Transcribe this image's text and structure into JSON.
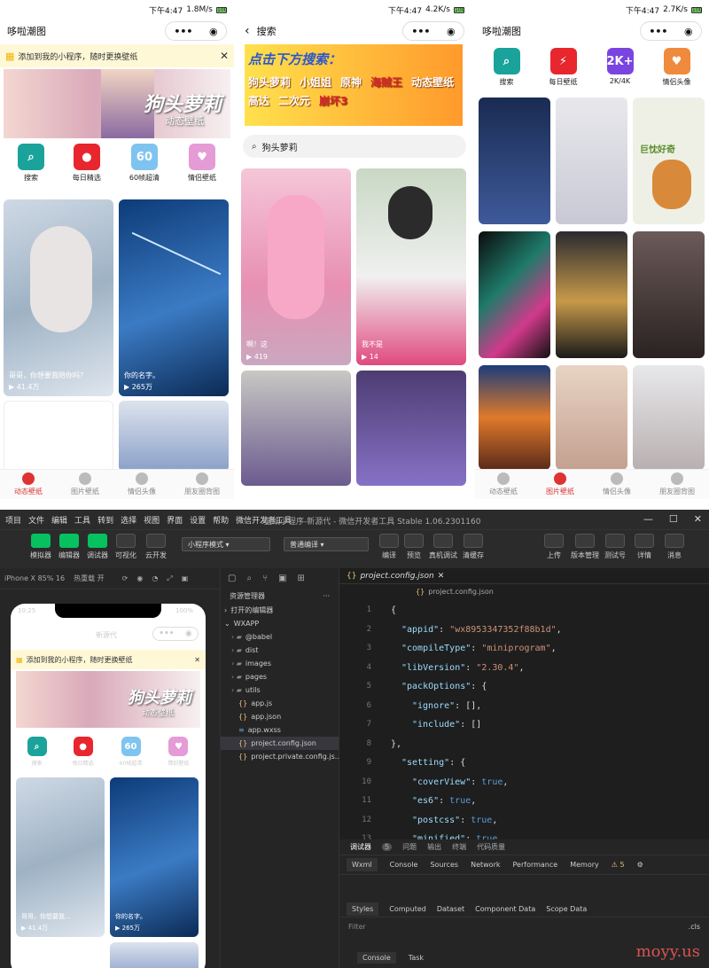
{
  "phones": [
    {
      "time": "下午4:47",
      "speed": "1.8M/s",
      "title": "哆啦潮图",
      "tip": "添加到我的小程序，随时更换壁纸",
      "banner_big": "狗头萝莉",
      "banner_small": "动态壁纸",
      "icons": [
        {
          "label": "搜索",
          "color": "#1aa39a",
          "glyph": "⌕"
        },
        {
          "label": "每日精选",
          "color": "#e8262d",
          "glyph": "●"
        },
        {
          "label": "60帧超清",
          "color": "#7fc4ef",
          "glyph": "60"
        },
        {
          "label": "情侣壁纸",
          "color": "#e59bd6",
          "glyph": "♥"
        }
      ],
      "cards": [
        {
          "caption": "哥哥，你想要我陪你吗？",
          "count": "41.4万"
        },
        {
          "caption": "你的名字。",
          "count": "265万"
        }
      ],
      "tabs": [
        "动态壁纸",
        "图片壁纸",
        "情侣头像",
        "朋友圈背图"
      ],
      "active_tab": 0
    },
    {
      "time": "下午4:47",
      "speed": "4.2K/s",
      "title": "搜索",
      "banner_line1": "点击下方搜索：",
      "banner_words": [
        "狗头萝莉",
        "小姐姐",
        "原神",
        "海贼王",
        "动态壁纸",
        "高达",
        "二次元",
        "崩坏3"
      ],
      "search_value": "狗头萝莉",
      "cards": [
        {
          "caption": "啊！这",
          "count": "419"
        },
        {
          "caption": "我不是",
          "count": "14"
        }
      ]
    },
    {
      "time": "下午4:47",
      "speed": "2.7K/s",
      "title": "哆啦潮图",
      "icons": [
        {
          "label": "搜索",
          "color": "#1aa39a",
          "glyph": "⌕"
        },
        {
          "label": "每日壁纸",
          "color": "#e8262d",
          "glyph": "⚡"
        },
        {
          "label": "2K/4K",
          "color": "#7a44e0",
          "glyph": "2K+"
        },
        {
          "label": "情侣头像",
          "color": "#f08a3c",
          "glyph": "♥"
        }
      ],
      "card3_text": "巨忱好奇",
      "tabs": [
        "动态壁纸",
        "图片壁纸",
        "情侣头像",
        "朋友圈背图"
      ],
      "active_tab": 1
    }
  ],
  "ide": {
    "menu": [
      "项目",
      "文件",
      "编辑",
      "工具",
      "转到",
      "选择",
      "视图",
      "界面",
      "设置",
      "帮助",
      "微信开发者工具"
    ],
    "window_title": "壁纸小程序-新源代 - 微信开发者工具 Stable 1.06.2301160",
    "tool_left": [
      "模拟器",
      "编辑器",
      "调试器",
      "可视化",
      "云开发"
    ],
    "mode": "小程序模式",
    "compile": "普通编译",
    "tool_mid": [
      "编译",
      "预览",
      "真机调试",
      "清缓存"
    ],
    "tool_right": [
      "上传",
      "版本管理",
      "测试号",
      "详情",
      "消息"
    ],
    "device": "iPhone X 85% 16",
    "hot_reload": "热重载 开",
    "sim_time": "10:25",
    "sim_battery": "100%",
    "sim_title": "新源代",
    "sim_tip": "添加到我的小程序，随时更换壁纸",
    "sim_cards": [
      {
        "caption": "哥哥，你想要我...",
        "count": "41.4万"
      },
      {
        "caption": "你的名字。",
        "count": "265万"
      }
    ],
    "explorer_title": "资源管理器",
    "open_editors": "打开的编辑器",
    "root": "WXAPP",
    "files": [
      "@babel",
      "dist",
      "images",
      "pages",
      "utils",
      "app.js",
      "app.json",
      "app.wxss",
      "project.config.json",
      "project.private.config.js..."
    ],
    "active_file": "project.config.json",
    "breadcrumb": "project.config.json",
    "code": [
      {
        "n": "1",
        "text": "{"
      },
      {
        "n": "2",
        "key": "\"appid\"",
        "val": "\"wx8953347352f88b1d\"",
        "end": ","
      },
      {
        "n": "3",
        "key": "\"compileType\"",
        "val": "\"miniprogram\"",
        "end": ","
      },
      {
        "n": "4",
        "key": "\"libVersion\"",
        "val": "\"2.30.4\"",
        "end": ","
      },
      {
        "n": "5",
        "key": "\"packOptions\"",
        "val": "{",
        "end": ""
      },
      {
        "n": "6",
        "key": "\"ignore\"",
        "val": "[]",
        "end": ",",
        "indent": 1
      },
      {
        "n": "7",
        "key": "\"include\"",
        "val": "[]",
        "end": "",
        "indent": 1
      },
      {
        "n": "8",
        "text": "},"
      },
      {
        "n": "9",
        "key": "\"setting\"",
        "val": "{",
        "end": ""
      },
      {
        "n": "10",
        "key": "\"coverView\"",
        "val": "true",
        "end": ",",
        "indent": 1,
        "bool": true
      },
      {
        "n": "11",
        "key": "\"es6\"",
        "val": "true",
        "end": ",",
        "indent": 1,
        "bool": true
      },
      {
        "n": "12",
        "key": "\"postcss\"",
        "val": "true",
        "end": ",",
        "indent": 1,
        "bool": true
      },
      {
        "n": "13",
        "key": "\"minified\"",
        "val": "true",
        "end": ",",
        "indent": 1,
        "bool": true
      }
    ],
    "debug_tabs": [
      "调试器",
      "问题",
      "输出",
      "终端",
      "代码质量"
    ],
    "debug_badge": "5",
    "dev_tabs": [
      "Wxml",
      "Console",
      "Sources",
      "Network",
      "Performance",
      "Memory"
    ],
    "warn_count": "5",
    "style_tabs": [
      "Styles",
      "Computed",
      "Dataset",
      "Component Data",
      "Scope Data"
    ],
    "filter": "Filter",
    "cls": ".cls",
    "console_tabs": [
      "Console",
      "Task"
    ]
  },
  "watermark": "moyy.us"
}
